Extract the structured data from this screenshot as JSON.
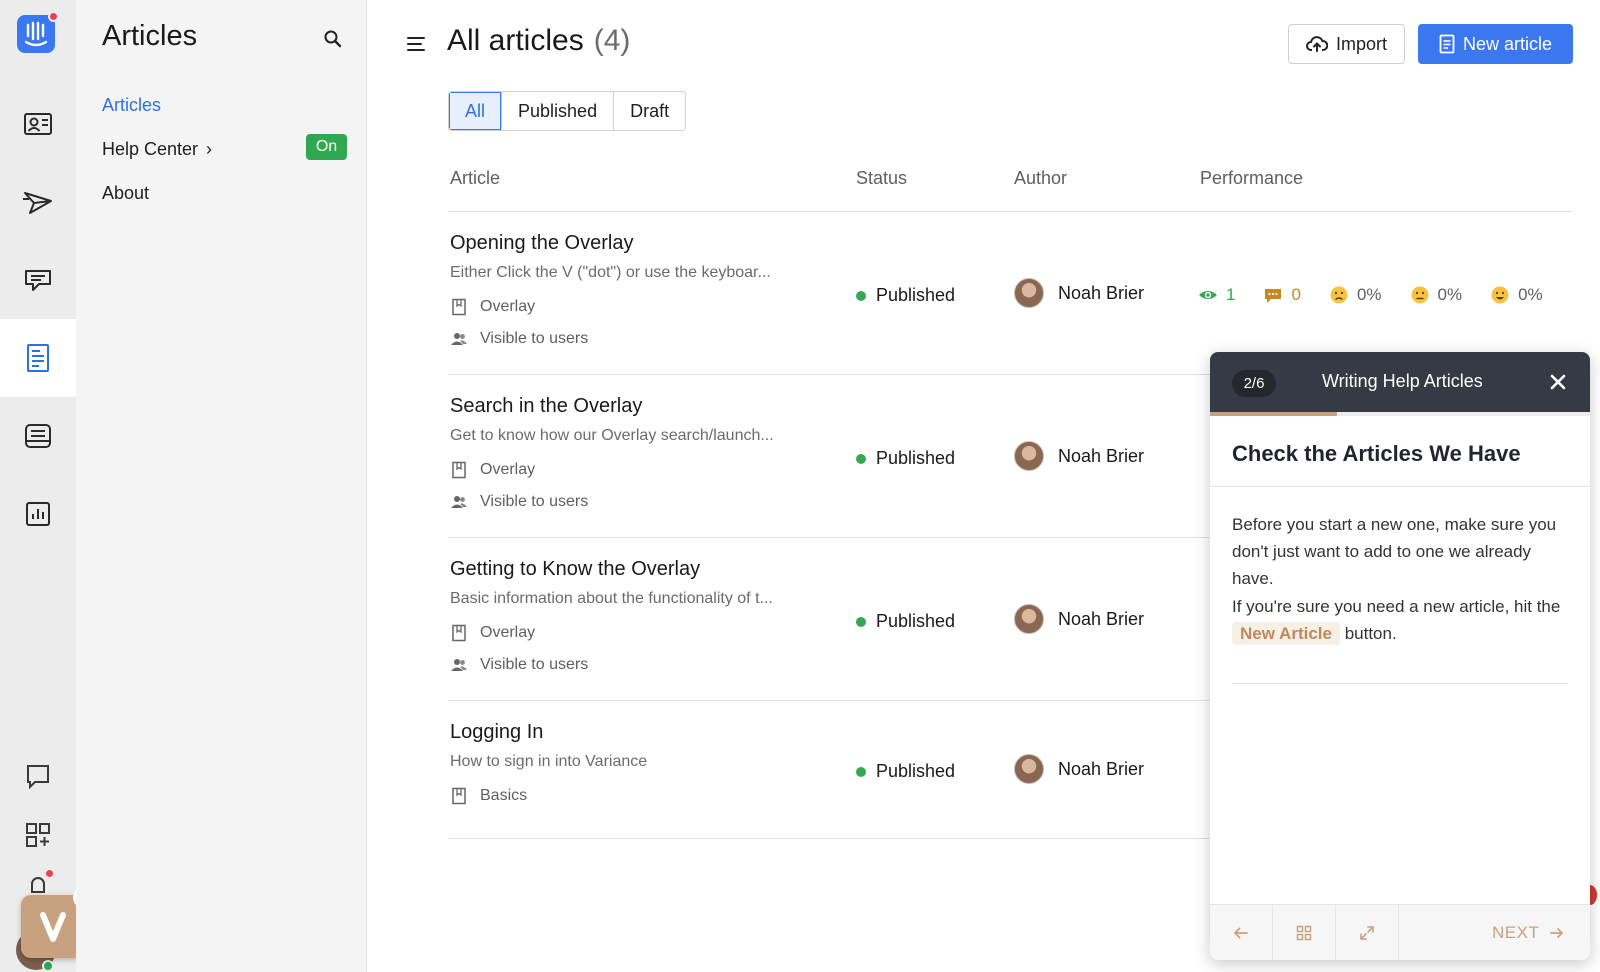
{
  "subnav": {
    "title": "Articles",
    "items": [
      {
        "label": "Articles",
        "active": true
      },
      {
        "label": "Help Center",
        "chevron": "›",
        "badge": "On"
      },
      {
        "label": "About"
      }
    ]
  },
  "header": {
    "title": "All articles",
    "count": "(4)",
    "import_label": "Import",
    "new_label": "New article"
  },
  "filters": [
    "All",
    "Published",
    "Draft"
  ],
  "columns": [
    "Article",
    "Status",
    "Author",
    "Performance"
  ],
  "articles": [
    {
      "title": "Opening the Overlay",
      "description": "Either Click the V (\"dot\") or use the keyboar...",
      "collection": "Overlay",
      "audience": "Visible to users",
      "status": "Published",
      "author": "Noah Brier",
      "views": "1",
      "conversations": "0",
      "sad": "0%",
      "neutral": "0%",
      "happy": "0%"
    },
    {
      "title": "Search in the Overlay",
      "description": "Get to know how our Overlay search/launch...",
      "collection": "Overlay",
      "audience": "Visible to users",
      "status": "Published",
      "author": "Noah Brier"
    },
    {
      "title": "Getting to Know the Overlay",
      "description": "Basic information about the functionality of t...",
      "collection": "Overlay",
      "audience": "Visible to users",
      "status": "Published",
      "author": "Noah Brier"
    },
    {
      "title": "Logging In",
      "description": "How to sign in into Variance",
      "collection": "Basics",
      "status": "Published",
      "author": "Noah Brier"
    }
  ],
  "tour": {
    "step": "2/6",
    "name": "Writing Help Articles",
    "progress": 0.333,
    "heading": "Check the Articles We Have",
    "para1": "Before you start a new one, make sure you don't just want to add to one we already have.",
    "para2_before": "If you're sure you need a new article, hit the",
    "para2_pill": "New Article",
    "para2_after": "button.",
    "next_label": "NEXT"
  },
  "colors": {
    "accent": "#3b78f0",
    "published": "#34a853",
    "on_badge": "#2fa84f",
    "tour_brand": "#c8a27e",
    "tour_header": "#363a45"
  },
  "icons": {
    "rail": [
      "intercom-logo-icon",
      "contacts-icon",
      "outbound-icon",
      "inbox-icon",
      "articles-icon",
      "messenger-icon",
      "reports-icon",
      "conversations-icon",
      "app-store-icon",
      "bell-icon"
    ],
    "misc": [
      "search-icon",
      "hamburger-icon",
      "cloud-upload-icon",
      "document-icon",
      "collection-icon",
      "users-icon",
      "eye-icon",
      "chat-bubble-icon",
      "sad-face-icon",
      "neutral-face-icon",
      "happy-face-icon",
      "close-icon",
      "arrow-left-icon",
      "grid-icon",
      "expand-icon",
      "arrow-right-icon"
    ]
  }
}
